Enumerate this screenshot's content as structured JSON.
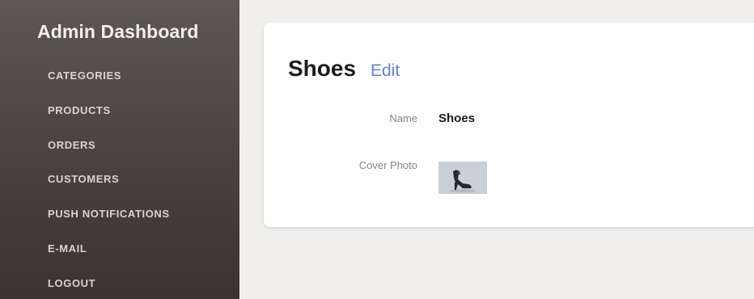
{
  "app": {
    "title": "Admin Dashboard"
  },
  "sidebar": {
    "items": [
      {
        "label": "CATEGORIES"
      },
      {
        "label": "PRODUCTS"
      },
      {
        "label": "ORDERS"
      },
      {
        "label": "CUSTOMERS"
      },
      {
        "label": "PUSH NOTIFICATIONS"
      },
      {
        "label": "E-MAIL"
      },
      {
        "label": "LOGOUT"
      }
    ]
  },
  "main": {
    "title": "Shoes",
    "edit_label": "Edit",
    "fields": {
      "name_label": "Name",
      "name_value": "Shoes",
      "photo_label": "Cover Photo",
      "photo_icon": "high-heel-shoe-image"
    }
  },
  "colors": {
    "sidebar_top": "#5e5852",
    "sidebar_bottom": "#39342f",
    "background": "#f1efec",
    "link": "#6a7fd0"
  }
}
